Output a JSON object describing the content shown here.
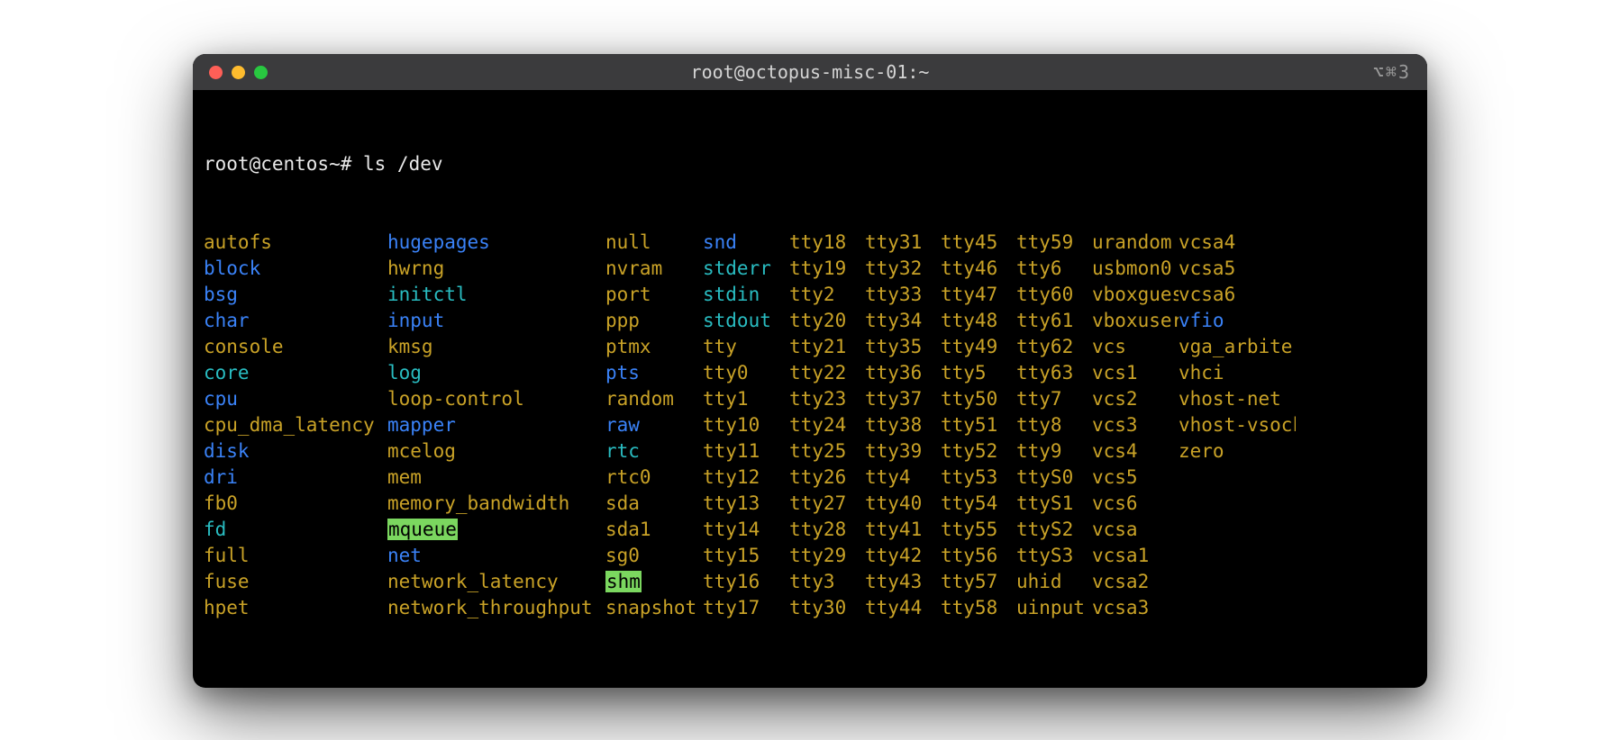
{
  "window": {
    "title": "root@octopus-misc-01:~",
    "right_badge": "⌥⌘3"
  },
  "prompt": "root@centos~# ls /dev",
  "colors": {
    "yellow": "#c9a227",
    "blue": "#3a82f7",
    "cyan": "#29bcc1",
    "hl_green_bg": "#7bd75f"
  },
  "listing": {
    "columns": [
      [
        {
          "t": "autofs",
          "c": "yellow"
        },
        {
          "t": "block",
          "c": "blue"
        },
        {
          "t": "bsg",
          "c": "blue"
        },
        {
          "t": "char",
          "c": "blue"
        },
        {
          "t": "console",
          "c": "yellow"
        },
        {
          "t": "core",
          "c": "cyan"
        },
        {
          "t": "cpu",
          "c": "blue"
        },
        {
          "t": "cpu_dma_latency",
          "c": "yellow"
        },
        {
          "t": "disk",
          "c": "blue"
        },
        {
          "t": "dri",
          "c": "blue"
        },
        {
          "t": "fb0",
          "c": "yellow"
        },
        {
          "t": "fd",
          "c": "cyan"
        },
        {
          "t": "full",
          "c": "yellow"
        },
        {
          "t": "fuse",
          "c": "yellow"
        },
        {
          "t": "hpet",
          "c": "yellow"
        }
      ],
      [
        {
          "t": "hugepages",
          "c": "blue"
        },
        {
          "t": "hwrng",
          "c": "yellow"
        },
        {
          "t": "initctl",
          "c": "cyan"
        },
        {
          "t": "input",
          "c": "blue"
        },
        {
          "t": "kmsg",
          "c": "yellow"
        },
        {
          "t": "log",
          "c": "cyan"
        },
        {
          "t": "loop-control",
          "c": "yellow"
        },
        {
          "t": "mapper",
          "c": "blue"
        },
        {
          "t": "mcelog",
          "c": "yellow"
        },
        {
          "t": "mem",
          "c": "yellow"
        },
        {
          "t": "memory_bandwidth",
          "c": "yellow"
        },
        {
          "t": "mqueue",
          "c": "hlgrn"
        },
        {
          "t": "net",
          "c": "blue"
        },
        {
          "t": "network_latency",
          "c": "yellow"
        },
        {
          "t": "network_throughput",
          "c": "yellow"
        }
      ],
      [
        {
          "t": "null",
          "c": "yellow"
        },
        {
          "t": "nvram",
          "c": "yellow"
        },
        {
          "t": "port",
          "c": "yellow"
        },
        {
          "t": "ppp",
          "c": "yellow"
        },
        {
          "t": "ptmx",
          "c": "yellow"
        },
        {
          "t": "pts",
          "c": "blue"
        },
        {
          "t": "random",
          "c": "yellow"
        },
        {
          "t": "raw",
          "c": "blue"
        },
        {
          "t": "rtc",
          "c": "cyan"
        },
        {
          "t": "rtc0",
          "c": "yellow"
        },
        {
          "t": "sda",
          "c": "yellow"
        },
        {
          "t": "sda1",
          "c": "yellow"
        },
        {
          "t": "sg0",
          "c": "yellow"
        },
        {
          "t": "shm",
          "c": "hlgrn"
        },
        {
          "t": "snapshot",
          "c": "yellow"
        }
      ],
      [
        {
          "t": "snd",
          "c": "blue"
        },
        {
          "t": "stderr",
          "c": "cyan"
        },
        {
          "t": "stdin",
          "c": "cyan"
        },
        {
          "t": "stdout",
          "c": "cyan"
        },
        {
          "t": "tty",
          "c": "yellow"
        },
        {
          "t": "tty0",
          "c": "yellow"
        },
        {
          "t": "tty1",
          "c": "yellow"
        },
        {
          "t": "tty10",
          "c": "yellow"
        },
        {
          "t": "tty11",
          "c": "yellow"
        },
        {
          "t": "tty12",
          "c": "yellow"
        },
        {
          "t": "tty13",
          "c": "yellow"
        },
        {
          "t": "tty14",
          "c": "yellow"
        },
        {
          "t": "tty15",
          "c": "yellow"
        },
        {
          "t": "tty16",
          "c": "yellow"
        },
        {
          "t": "tty17",
          "c": "yellow"
        }
      ],
      [
        {
          "t": "tty18",
          "c": "yellow"
        },
        {
          "t": "tty19",
          "c": "yellow"
        },
        {
          "t": "tty2",
          "c": "yellow"
        },
        {
          "t": "tty20",
          "c": "yellow"
        },
        {
          "t": "tty21",
          "c": "yellow"
        },
        {
          "t": "tty22",
          "c": "yellow"
        },
        {
          "t": "tty23",
          "c": "yellow"
        },
        {
          "t": "tty24",
          "c": "yellow"
        },
        {
          "t": "tty25",
          "c": "yellow"
        },
        {
          "t": "tty26",
          "c": "yellow"
        },
        {
          "t": "tty27",
          "c": "yellow"
        },
        {
          "t": "tty28",
          "c": "yellow"
        },
        {
          "t": "tty29",
          "c": "yellow"
        },
        {
          "t": "tty3",
          "c": "yellow"
        },
        {
          "t": "tty30",
          "c": "yellow"
        }
      ],
      [
        {
          "t": "tty31",
          "c": "yellow"
        },
        {
          "t": "tty32",
          "c": "yellow"
        },
        {
          "t": "tty33",
          "c": "yellow"
        },
        {
          "t": "tty34",
          "c": "yellow"
        },
        {
          "t": "tty35",
          "c": "yellow"
        },
        {
          "t": "tty36",
          "c": "yellow"
        },
        {
          "t": "tty37",
          "c": "yellow"
        },
        {
          "t": "tty38",
          "c": "yellow"
        },
        {
          "t": "tty39",
          "c": "yellow"
        },
        {
          "t": "tty4",
          "c": "yellow"
        },
        {
          "t": "tty40",
          "c": "yellow"
        },
        {
          "t": "tty41",
          "c": "yellow"
        },
        {
          "t": "tty42",
          "c": "yellow"
        },
        {
          "t": "tty43",
          "c": "yellow"
        },
        {
          "t": "tty44",
          "c": "yellow"
        }
      ],
      [
        {
          "t": "tty45",
          "c": "yellow"
        },
        {
          "t": "tty46",
          "c": "yellow"
        },
        {
          "t": "tty47",
          "c": "yellow"
        },
        {
          "t": "tty48",
          "c": "yellow"
        },
        {
          "t": "tty49",
          "c": "yellow"
        },
        {
          "t": "tty5",
          "c": "yellow"
        },
        {
          "t": "tty50",
          "c": "yellow"
        },
        {
          "t": "tty51",
          "c": "yellow"
        },
        {
          "t": "tty52",
          "c": "yellow"
        },
        {
          "t": "tty53",
          "c": "yellow"
        },
        {
          "t": "tty54",
          "c": "yellow"
        },
        {
          "t": "tty55",
          "c": "yellow"
        },
        {
          "t": "tty56",
          "c": "yellow"
        },
        {
          "t": "tty57",
          "c": "yellow"
        },
        {
          "t": "tty58",
          "c": "yellow"
        }
      ],
      [
        {
          "t": "tty59",
          "c": "yellow"
        },
        {
          "t": "tty6",
          "c": "yellow"
        },
        {
          "t": "tty60",
          "c": "yellow"
        },
        {
          "t": "tty61",
          "c": "yellow"
        },
        {
          "t": "tty62",
          "c": "yellow"
        },
        {
          "t": "tty63",
          "c": "yellow"
        },
        {
          "t": "tty7",
          "c": "yellow"
        },
        {
          "t": "tty8",
          "c": "yellow"
        },
        {
          "t": "tty9",
          "c": "yellow"
        },
        {
          "t": "ttyS0",
          "c": "yellow"
        },
        {
          "t": "ttyS1",
          "c": "yellow"
        },
        {
          "t": "ttyS2",
          "c": "yellow"
        },
        {
          "t": "ttyS3",
          "c": "yellow"
        },
        {
          "t": "uhid",
          "c": "yellow"
        },
        {
          "t": "uinput",
          "c": "yellow"
        }
      ],
      [
        {
          "t": "urandom",
          "c": "yellow"
        },
        {
          "t": "usbmon0",
          "c": "yellow"
        },
        {
          "t": "vboxguest",
          "c": "yellow"
        },
        {
          "t": "vboxuser",
          "c": "yellow"
        },
        {
          "t": "vcs",
          "c": "yellow"
        },
        {
          "t": "vcs1",
          "c": "yellow"
        },
        {
          "t": "vcs2",
          "c": "yellow"
        },
        {
          "t": "vcs3",
          "c": "yellow"
        },
        {
          "t": "vcs4",
          "c": "yellow"
        },
        {
          "t": "vcs5",
          "c": "yellow"
        },
        {
          "t": "vcs6",
          "c": "yellow"
        },
        {
          "t": "vcsa",
          "c": "yellow"
        },
        {
          "t": "vcsa1",
          "c": "yellow"
        },
        {
          "t": "vcsa2",
          "c": "yellow"
        },
        {
          "t": "vcsa3",
          "c": "yellow"
        }
      ],
      [
        {
          "t": "vcsa4",
          "c": "yellow"
        },
        {
          "t": "vcsa5",
          "c": "yellow"
        },
        {
          "t": "vcsa6",
          "c": "yellow"
        },
        {
          "t": "vfio",
          "c": "blue"
        },
        {
          "t": "vga_arbiter",
          "c": "yellow"
        },
        {
          "t": "vhci",
          "c": "yellow"
        },
        {
          "t": "vhost-net",
          "c": "yellow"
        },
        {
          "t": "vhost-vsock",
          "c": "yellow"
        },
        {
          "t": "zero",
          "c": "yellow"
        },
        {
          "t": "",
          "c": ""
        },
        {
          "t": "",
          "c": ""
        },
        {
          "t": "",
          "c": ""
        },
        {
          "t": "",
          "c": ""
        },
        {
          "t": "",
          "c": ""
        },
        {
          "t": "",
          "c": ""
        }
      ]
    ]
  }
}
